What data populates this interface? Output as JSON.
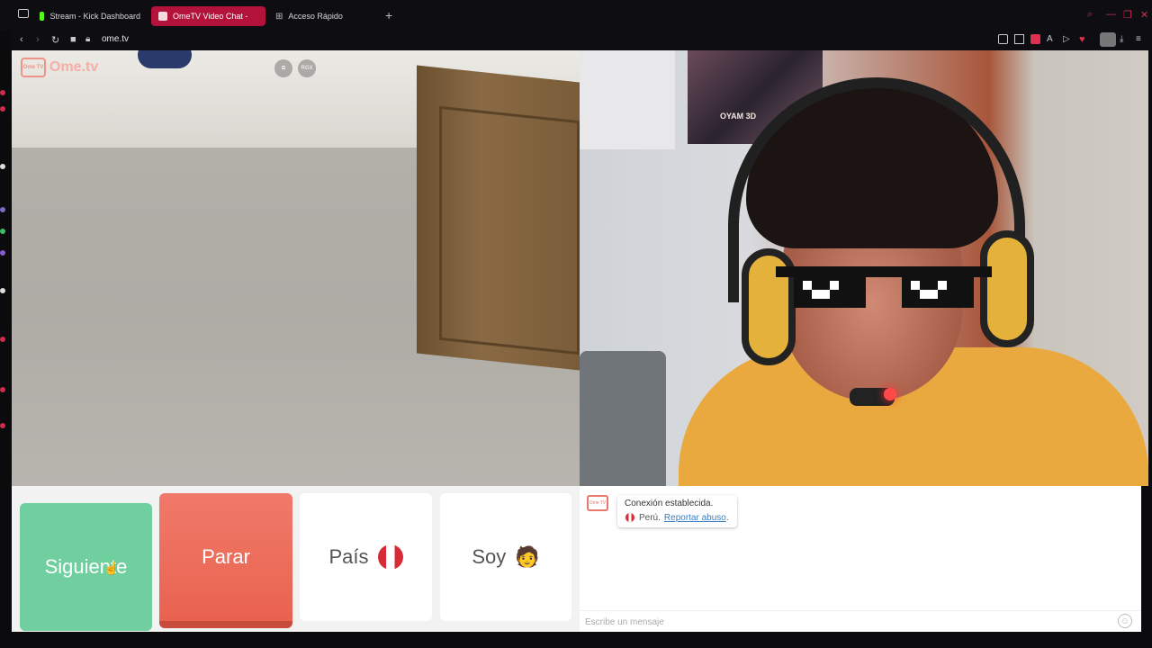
{
  "browser": {
    "tabs": [
      {
        "label": "Stream - Kick Dashboard",
        "favicon_color": "#53fc18"
      },
      {
        "label": "OmeTV Video Chat -",
        "favicon_color": "#ffffff"
      },
      {
        "label": "Acceso Rápido",
        "favicon_color": "#bdbdc2"
      }
    ],
    "url": "ome.tv",
    "accent": "#b3123b"
  },
  "left_video": {
    "logo_box_text": "Ome TV",
    "logo_text": "Ome.tv",
    "buttons": [
      {
        "icon": "pip-icon",
        "glyph": "⧉"
      },
      {
        "icon": "resolution-icon",
        "glyph": "RGX"
      }
    ]
  },
  "right_video": {
    "poster_text": "OYAM 3D"
  },
  "controls": {
    "next_label": "Siguiente",
    "stop_label": "Parar",
    "country_label": "País",
    "gender_label": "Soy",
    "gender_emoji": "🧑",
    "next_color": "#6fcf9e",
    "stop_color": "#e9624f"
  },
  "chat": {
    "logo_text": "Ome TV",
    "message_line1": "Conexión establecida.",
    "country_name": "Perú.",
    "report_link": "Reportar abuso",
    "report_suffix": ".",
    "input_placeholder": "Escribe un mensaje",
    "emoji_icon": "☺"
  }
}
